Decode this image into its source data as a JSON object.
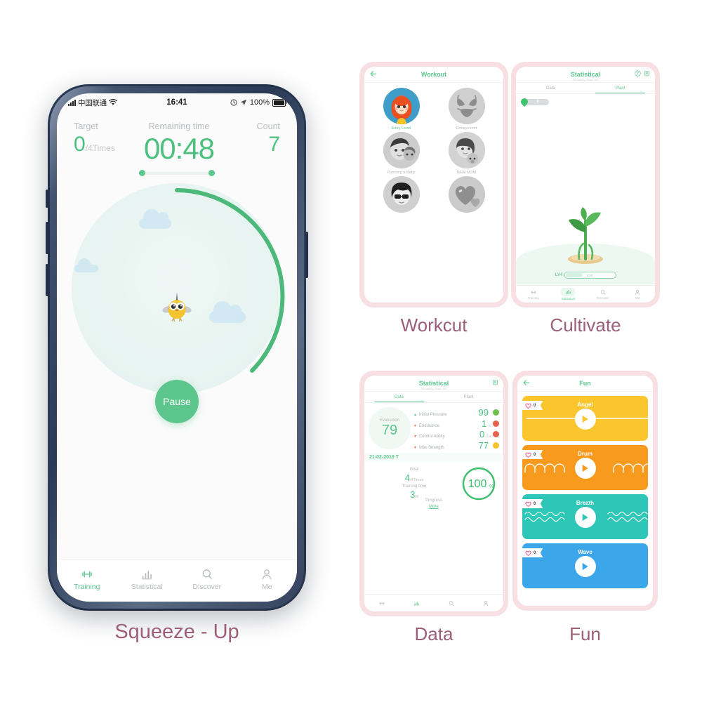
{
  "main_phone": {
    "status_bar": {
      "carrier": "中国联通",
      "time": "16:41",
      "battery": "100%",
      "wifi_icon": "wifi-icon",
      "signal_icon": "signal-icon",
      "location_icon": "location-arrow-icon",
      "alarm_icon": "alarm-icon"
    },
    "metrics": {
      "target_label": "Target",
      "target_value": "0",
      "target_unit": "/4Times",
      "timer_label": "Remaining time",
      "timer_value": "00:48",
      "count_label": "Count",
      "count_value": "7"
    },
    "pause_label": "Pause",
    "progress_arc_percent": 45,
    "tabbar": [
      {
        "label": "Training",
        "icon": "dumbbell-icon",
        "active": true
      },
      {
        "label": "Statistical",
        "icon": "bar-chart-icon",
        "active": false
      },
      {
        "label": "Discover",
        "icon": "search-icon",
        "active": false
      },
      {
        "label": "Me",
        "icon": "person-icon",
        "active": false
      }
    ],
    "caption": "Squeeze - Up"
  },
  "workout_phone": {
    "header": {
      "title": "Workout",
      "back_icon": "back-arrow-icon"
    },
    "items": [
      {
        "label": "Entry Level",
        "selected": true,
        "avatar": "girl-avatar"
      },
      {
        "label": "Honeymoon",
        "selected": false,
        "avatar": "bikini-avatar"
      },
      {
        "label": "Planning a Baby",
        "selected": false,
        "avatar": "couple-avatar"
      },
      {
        "label": "NEW MOM",
        "selected": false,
        "avatar": "mom-baby-avatar"
      },
      {
        "label": "",
        "selected": false,
        "avatar": "sunglasses-avatar"
      },
      {
        "label": "",
        "selected": false,
        "avatar": "heart-avatar"
      }
    ],
    "caption": "Workcut"
  },
  "cultivate_phone": {
    "header": {
      "title": "Statistical",
      "subtitle": "Remaining Days 100",
      "help_icon": "help-circle-icon",
      "calendar_icon": "calendar-icon"
    },
    "tabs": [
      {
        "label": "Data",
        "active": false
      },
      {
        "label": "Plant",
        "active": true
      }
    ],
    "water": {
      "icon": "water-drop-icon",
      "count": "0"
    },
    "plant": {
      "level": "LV4",
      "exp_label": "EXP",
      "exp_percent": 32,
      "icon": "sprout-icon"
    },
    "tabbar": [
      {
        "label": "Training",
        "icon": "dumbbell-icon",
        "active": false
      },
      {
        "label": "Statistical",
        "icon": "bar-chart-icon",
        "active": true
      },
      {
        "label": "Discover",
        "icon": "search-icon",
        "active": false
      },
      {
        "label": "Me",
        "icon": "person-icon",
        "active": false
      }
    ],
    "caption": "Cultivate"
  },
  "data_phone": {
    "header": {
      "title": "Statistical",
      "subtitle": "Remaining Days 100",
      "calendar_icon": "calendar-icon"
    },
    "tabs": [
      {
        "label": "Data",
        "active": true
      },
      {
        "label": "Plant",
        "active": false
      }
    ],
    "evaluation": {
      "label": "Evaluation",
      "value": "79"
    },
    "stats": [
      {
        "name": "Initial Pressure",
        "value": "99",
        "unit": "",
        "trend": "up",
        "face": "happy",
        "face_color": "#6cc24a"
      },
      {
        "name": "Endurance",
        "value": "1",
        "unit": "s",
        "trend": "down",
        "face": "sad",
        "face_color": "#e8614d"
      },
      {
        "name": "Control Ability",
        "value": "0",
        "unit": "Lv",
        "trend": "down",
        "face": "sad",
        "face_color": "#e8614d"
      },
      {
        "name": "Max Strength",
        "value": "77",
        "unit": "",
        "trend": "down",
        "face": "neutral",
        "face_color": "#f5c531"
      }
    ],
    "date": "21-02-2019 T",
    "goal": {
      "label": "Goal",
      "value": "4",
      "unit": "/4Times"
    },
    "training_time": {
      "label": "Training time",
      "value": "3",
      "unit": "M"
    },
    "progress": {
      "value": "100",
      "unit": "%",
      "label": "Progress",
      "percent": 100
    },
    "more_label": "More",
    "tabbar": [
      {
        "label": "",
        "icon": "dumbbell-icon",
        "active": false
      },
      {
        "label": "",
        "icon": "bar-chart-icon",
        "active": true
      },
      {
        "label": "",
        "icon": "search-icon",
        "active": false
      },
      {
        "label": "",
        "icon": "person-icon",
        "active": false
      }
    ],
    "caption": "Data"
  },
  "fun_phone": {
    "header": {
      "title": "Fun",
      "back_icon": "back-arrow-icon"
    },
    "cards": [
      {
        "title": "Angel",
        "likes": "0",
        "color": "#fbc52d",
        "wave": "flat"
      },
      {
        "title": "Drum",
        "likes": "0",
        "color": "#f79a1e",
        "wave": "bumps"
      },
      {
        "title": "Breath",
        "likes": "0",
        "color": "#2ec6b6",
        "wave": "zigzag"
      },
      {
        "title": "Wave",
        "likes": "0",
        "color": "#3ba7ea",
        "wave": "flat"
      }
    ],
    "heart_icon": "heart-icon",
    "play_icon": "play-icon",
    "caption": "Fun"
  },
  "colors": {
    "accent_green": "#5cc68d",
    "caption_mauve": "#9b5f77",
    "frame_navy": "#2b3a55",
    "mini_frame_pink": "#f7dfe4"
  }
}
